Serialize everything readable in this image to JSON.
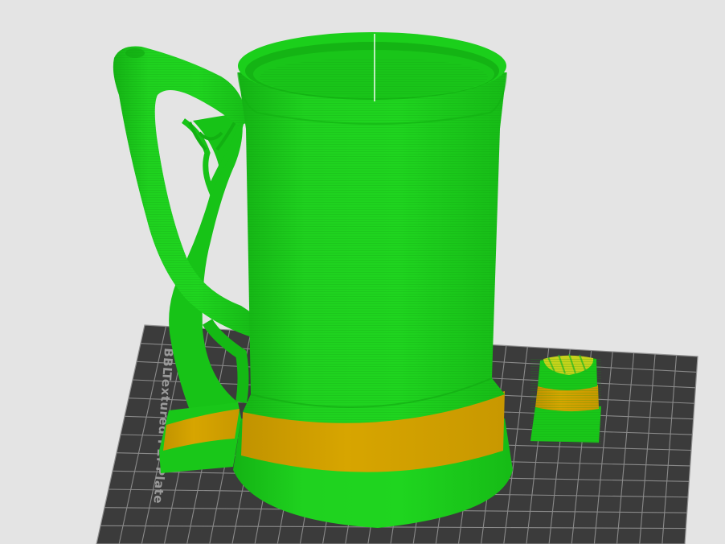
{
  "viewport": {
    "background": "#e4e4e4"
  },
  "build_plate": {
    "label": "Textured PEI Plate",
    "brand_mark": "BBL",
    "plate_color": "#3a3a3a",
    "grid_color": "#8c8c8c",
    "label_color": "#9a9a9a"
  },
  "mug": {
    "feature_color": "#19c719",
    "band_color": "#d4a200"
  },
  "side_part": {
    "feature_color": "#19c719",
    "band_color": "#d4a200"
  }
}
